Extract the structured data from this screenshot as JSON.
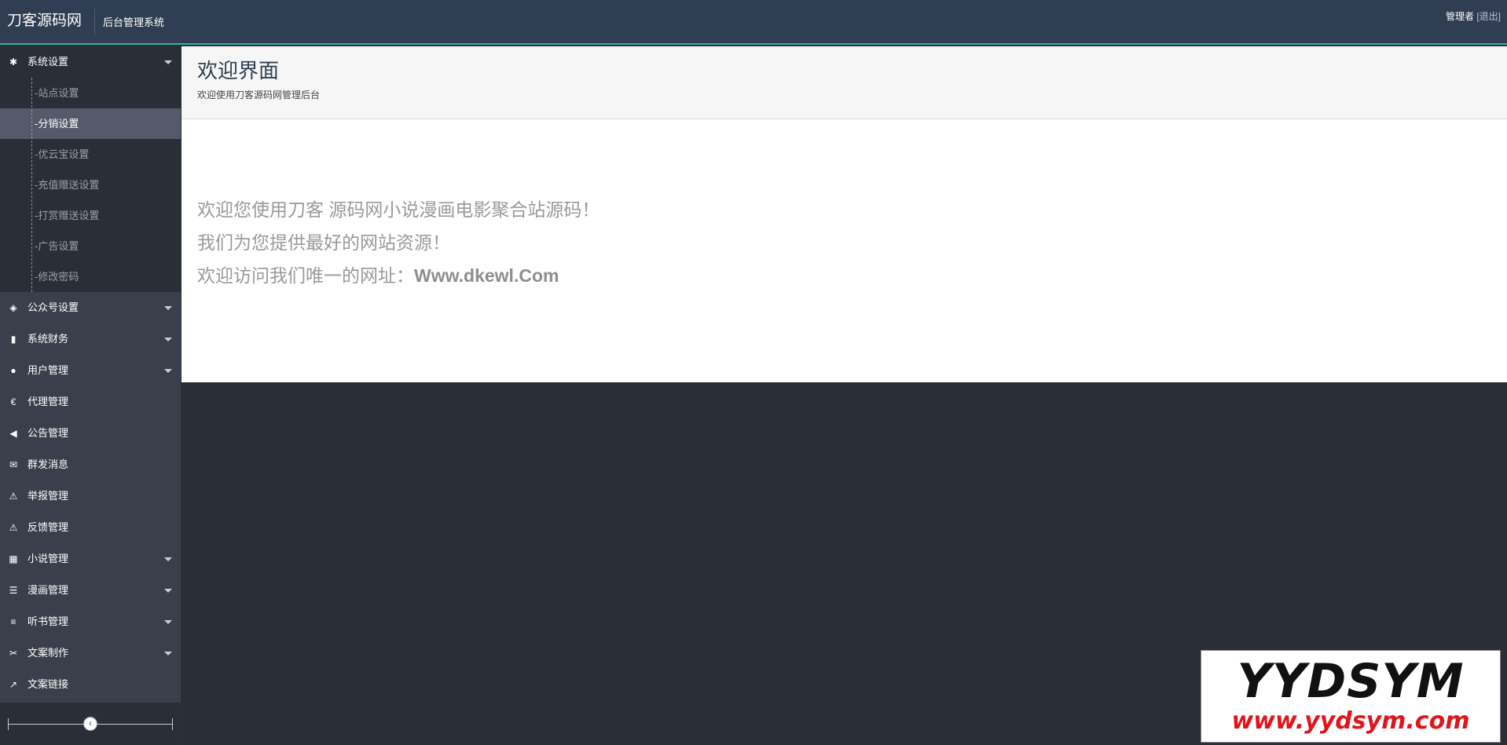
{
  "header": {
    "brand": "刀客源码网",
    "subtitle": "后台管理系统",
    "user": "管理者",
    "logout": "[退出]"
  },
  "sidebar": {
    "items": [
      {
        "label": "系统设置",
        "icon": "gear-icon",
        "glyph": "✱",
        "caret": true,
        "open": true,
        "children": [
          {
            "label": "-站点设置"
          },
          {
            "label": "-分销设置",
            "active": true
          },
          {
            "label": "-优云宝设置"
          },
          {
            "label": "-充值赠送设置"
          },
          {
            "label": "-打赏赠送设置"
          },
          {
            "label": "-广告设置"
          },
          {
            "label": "-修改密码"
          }
        ]
      },
      {
        "label": "公众号设置",
        "icon": "tags-icon",
        "glyph": "◈",
        "caret": true
      },
      {
        "label": "系统财务",
        "icon": "bar-chart-icon",
        "glyph": "▮",
        "caret": true
      },
      {
        "label": "用户管理",
        "icon": "user-icon",
        "glyph": "●",
        "caret": true
      },
      {
        "label": "代理管理",
        "icon": "euro-icon",
        "glyph": "€",
        "caret": false
      },
      {
        "label": "公告管理",
        "icon": "bullhorn-icon",
        "glyph": "◀",
        "caret": false
      },
      {
        "label": "群发消息",
        "icon": "envelope-icon",
        "glyph": "✉",
        "caret": false
      },
      {
        "label": "举报管理",
        "icon": "warning-icon",
        "glyph": "⚠",
        "caret": false
      },
      {
        "label": "反馈管理",
        "icon": "warning-icon",
        "glyph": "⚠",
        "caret": false
      },
      {
        "label": "小说管理",
        "icon": "grid-icon",
        "glyph": "▦",
        "caret": true
      },
      {
        "label": "漫画管理",
        "icon": "list-icon",
        "glyph": "☰",
        "caret": true
      },
      {
        "label": "听书管理",
        "icon": "stack-icon",
        "glyph": "≡",
        "caret": true
      },
      {
        "label": "文案制作",
        "icon": "tools-icon",
        "glyph": "✂",
        "caret": true
      },
      {
        "label": "文案链接",
        "icon": "share-icon",
        "glyph": "↗",
        "caret": false
      }
    ],
    "collapse_glyph": "‹"
  },
  "main": {
    "title": "欢迎界面",
    "subtitle": "欢迎使用刀客源码网管理后台",
    "welcome_line1": "欢迎您使用刀客 源码网小说漫画电影聚合站源码！",
    "welcome_line2": "我们为您提供最好的网站资源！",
    "welcome_line3_prefix": "欢迎访问我们唯一的网址：",
    "welcome_url": "Www.dkewl.Com"
  },
  "watermark": {
    "top": "YYDSYM",
    "bottom": "www.yydsym.com"
  }
}
